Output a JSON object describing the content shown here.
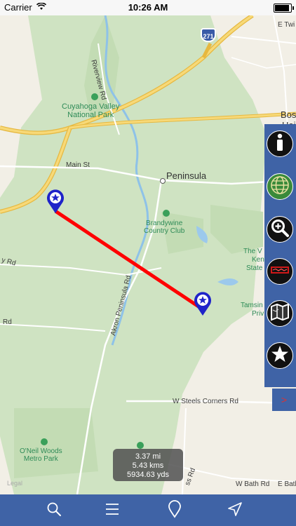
{
  "status_bar": {
    "carrier": "Carrier",
    "time": "10:26 AM"
  },
  "map": {
    "labels": {
      "riverview_rd": "Riverview Rd",
      "park": "Cuyahoga Valley\nNational Park",
      "main_st": "Main St",
      "peninsula": "Peninsula",
      "brandywine": "Brandywine\nCountry Club",
      "akron_peninsula_rd": "Akron Peninsula Rd",
      "the_v": "The V",
      "ken": "Ken",
      "state": "State",
      "tamsin": "Tamsin",
      "priv": "Priv",
      "steels": "W Steels Corners Rd",
      "oneil": "O'Neil Woods\nMetro Park",
      "bath": "W Bath Rd",
      "e_bath": "E Bath",
      "e_twi": "E Twi",
      "bos": "Bos",
      "hei": "Hei",
      "rd_left": "Rd",
      "y_rd": "y Rd",
      "highway": "271",
      "ss_rd": "ss Rd"
    },
    "legal": "Legal"
  },
  "measure": {
    "miles": "3.37 mi",
    "kms": "5.43 kms",
    "yds": "5934.63 yds"
  },
  "side_buttons": [
    {
      "name": "info-button",
      "icon": "info-icon"
    },
    {
      "name": "map-type-button",
      "icon": "globe-icon"
    },
    {
      "name": "zoom-button",
      "icon": "zoom-icon"
    },
    {
      "name": "route-button",
      "icon": "route-icon"
    },
    {
      "name": "maps-button",
      "icon": "map-icon"
    },
    {
      "name": "favorites-button",
      "icon": "star-icon"
    }
  ],
  "expand_label": ">",
  "toolbar": {
    "icons": [
      "search-icon",
      "menu-icon",
      "pin-icon",
      "location-icon"
    ]
  },
  "colors": {
    "bar": "#3f63a6",
    "line": "#ff0000",
    "pin": "#1f23c9"
  }
}
